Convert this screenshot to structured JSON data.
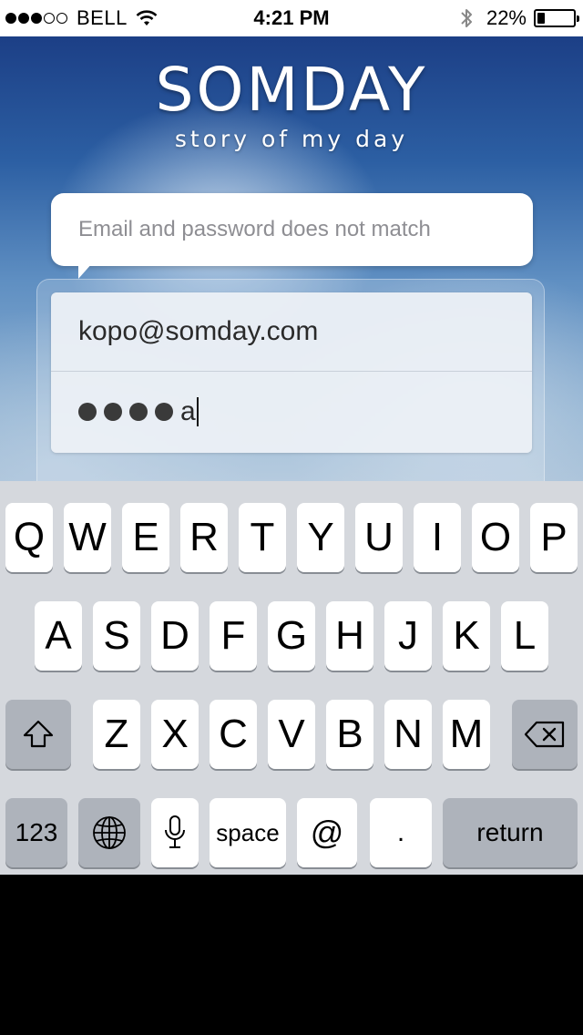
{
  "status_bar": {
    "carrier": "BELL",
    "time": "4:21 PM",
    "battery_percent": "22%",
    "battery_level": 0.22,
    "signal_strength": 3,
    "signal_max": 5
  },
  "app": {
    "title": "SOMDAY",
    "subtitle": "story of my day"
  },
  "error_message": "Email and password does not match",
  "login_form": {
    "email_value": "kopo@somday.com",
    "password_masked_count": 4,
    "password_visible_char": "a"
  },
  "keyboard": {
    "row1": [
      "Q",
      "W",
      "E",
      "R",
      "T",
      "Y",
      "U",
      "I",
      "O",
      "P"
    ],
    "row2": [
      "A",
      "S",
      "D",
      "F",
      "G",
      "H",
      "J",
      "K",
      "L"
    ],
    "row3": [
      "Z",
      "X",
      "C",
      "V",
      "B",
      "N",
      "M"
    ],
    "numbers_label": "123",
    "space_label": "space",
    "at_label": "@",
    "period_label": ".",
    "return_label": "return",
    "icons": {
      "shift": "shift-icon",
      "delete": "delete-icon",
      "globe": "globe-icon",
      "mic": "microphone-icon"
    }
  }
}
